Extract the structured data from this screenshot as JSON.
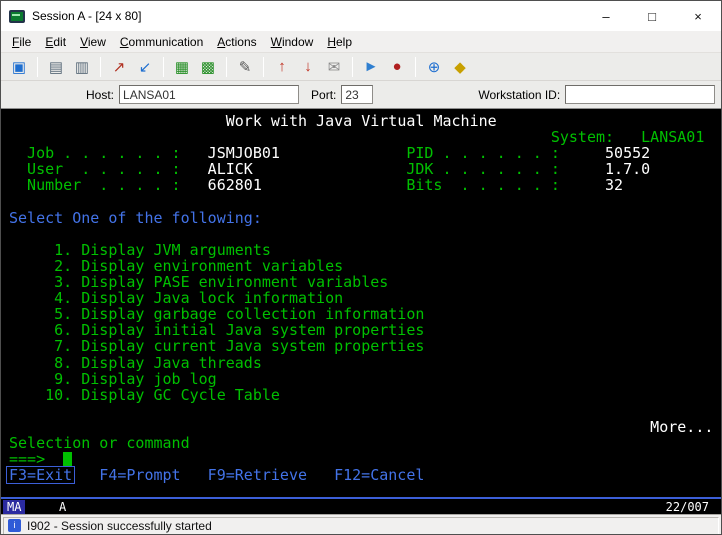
{
  "window": {
    "title": "Session A - [24 x 80]",
    "minimize": "–",
    "maximize": "□",
    "close": "×"
  },
  "menu": {
    "items": [
      "File",
      "Edit",
      "View",
      "Communication",
      "Actions",
      "Window",
      "Help"
    ]
  },
  "toolbar": {
    "icons": [
      {
        "name": "new-session-icon",
        "glyph": "▣"
      },
      {
        "name": "copy-icon",
        "glyph": "▤"
      },
      {
        "name": "paste-icon",
        "glyph": "▥"
      },
      {
        "name": "send-screen-icon",
        "glyph": "↗"
      },
      {
        "name": "receive-screen-icon",
        "glyph": "↙"
      },
      {
        "name": "display-colors-icon",
        "glyph": "▦"
      },
      {
        "name": "display-setup-icon",
        "glyph": "▩"
      },
      {
        "name": "edit-macro-icon",
        "glyph": "✎"
      },
      {
        "name": "send-file-icon",
        "glyph": "↑"
      },
      {
        "name": "receive-file-icon",
        "glyph": "↓"
      },
      {
        "name": "transfer-file-icon",
        "glyph": "✉"
      },
      {
        "name": "play-macro-icon",
        "glyph": "►"
      },
      {
        "name": "record-macro-icon",
        "glyph": "●"
      },
      {
        "name": "web-browser-icon",
        "glyph": "⊕"
      },
      {
        "name": "index-icon",
        "glyph": "◆"
      }
    ]
  },
  "hostbar": {
    "host_label": "Host:",
    "host_value": "LANSA01",
    "port_label": "Port:",
    "port_value": "23",
    "workstation_label": "Workstation ID:",
    "workstation_value": ""
  },
  "terminal": {
    "title": "Work with Java Virtual Machine",
    "system": {
      "label": "System:",
      "value": "LANSA01"
    },
    "job": {
      "label": "Job . . . . . . :",
      "value": "JSMJOB01"
    },
    "user": {
      "label": "User  . . . . . :",
      "value": "ALICK"
    },
    "number": {
      "label": "Number  . . . . :",
      "value": "662801"
    },
    "pid": {
      "label": "PID . . . . . . :",
      "value": "50552"
    },
    "jdk": {
      "label": "JDK . . . . . . :",
      "value": "1.7.0"
    },
    "bits": {
      "label": "Bits  . . . . . :",
      "value": "32"
    },
    "select_prompt": "Select One of the following:",
    "options": [
      {
        "num": "1.",
        "text": "Display JVM arguments"
      },
      {
        "num": "2.",
        "text": "Display environment variables"
      },
      {
        "num": "3.",
        "text": "Display PASE environment variables"
      },
      {
        "num": "4.",
        "text": "Display Java lock information"
      },
      {
        "num": "5.",
        "text": "Display garbage collection information"
      },
      {
        "num": "6.",
        "text": "Display initial Java system properties"
      },
      {
        "num": "7.",
        "text": "Display current Java system properties"
      },
      {
        "num": "8.",
        "text": "Display Java threads"
      },
      {
        "num": "9.",
        "text": "Display job log"
      },
      {
        "num": "10.",
        "text": "Display GC Cycle Table"
      }
    ],
    "more": "More...",
    "selection_label": "Selection or command",
    "prompt": "===>",
    "fkeys": [
      "F3=Exit",
      "F4=Prompt",
      "F9=Retrieve",
      "F12=Cancel"
    ],
    "oia": {
      "ma": "MA",
      "kb": "A",
      "cursor_pos": "22/007"
    }
  },
  "statusbar": {
    "message": "I902 - Session successfully started"
  },
  "colors": {
    "terminal_bg": "#000000",
    "terminal_green": "#00c000",
    "terminal_blue": "#4373e8",
    "terminal_white": "#ffffff",
    "oia_separator_blue": "#3c5fd8"
  }
}
